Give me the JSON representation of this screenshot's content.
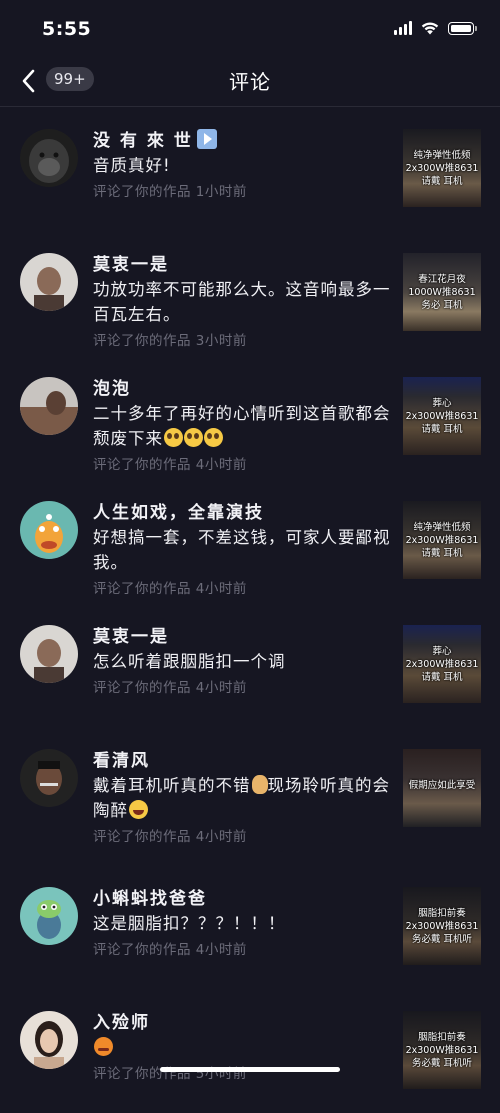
{
  "status_bar": {
    "time": "5:55"
  },
  "nav": {
    "badge": "99+",
    "title": "评论"
  },
  "comments": [
    {
      "name": "没 有 來 世",
      "text": "音质真好!",
      "meta": "评论了你的作品  1小时前",
      "thumb_text": "纯净弹性低频\n2x300W推8631\n请戴   耳机"
    },
    {
      "name": "莫衷一是",
      "text": "功放功率不可能那么大。这音响最多一百瓦左右。",
      "meta": "评论了你的作品  3小时前",
      "thumb_text": "春江花月夜\n1000W推8631\n务必   耳机"
    },
    {
      "name": "泡泡",
      "text": "二十多年了再好的心情听到这首歌都会颓废下来",
      "meta": "评论了你的作品  4小时前",
      "thumb_text": "葬心\n2x300W推8631\n请戴   耳机"
    },
    {
      "name": "人生如戏，全靠演技",
      "text": "好想搞一套，不差这钱，可家人要鄙视我。",
      "meta": "评论了你的作品  4小时前",
      "thumb_text": "纯净弹性低频\n2x300W推8631\n请戴   耳机"
    },
    {
      "name": "莫衷一是",
      "text": "怎么听着跟胭脂扣一个调",
      "meta": "评论了你的作品  4小时前",
      "thumb_text": "葬心\n2x300W推8631\n请戴   耳机"
    },
    {
      "name": "看清风",
      "text": "戴着耳机听真的不错",
      "text2": "现场聆听真的会陶醉",
      "meta": "评论了你的作品  4小时前",
      "thumb_text": "假期应如此享受"
    },
    {
      "name": "小蝌蚪找爸爸",
      "text": "这是胭脂扣？？？！！！",
      "meta": "评论了你的作品  4小时前",
      "thumb_text": "胭脂扣前奏\n2x300W推8631\n务必戴   耳机听"
    },
    {
      "name": "入殓师",
      "text": "",
      "meta": "评论了你的作品  5小时前",
      "thumb_text": "胭脂扣前奏\n2x300W推8631\n务必戴   耳机听"
    }
  ],
  "icons": {
    "back": "chevron-left-icon",
    "signal": "cellular-signal-icon",
    "wifi": "wifi-icon",
    "battery": "battery-icon"
  },
  "colors": {
    "background": "#161622",
    "meta_text": "#6c6c7a",
    "badge_bg": "#3a3a46"
  }
}
